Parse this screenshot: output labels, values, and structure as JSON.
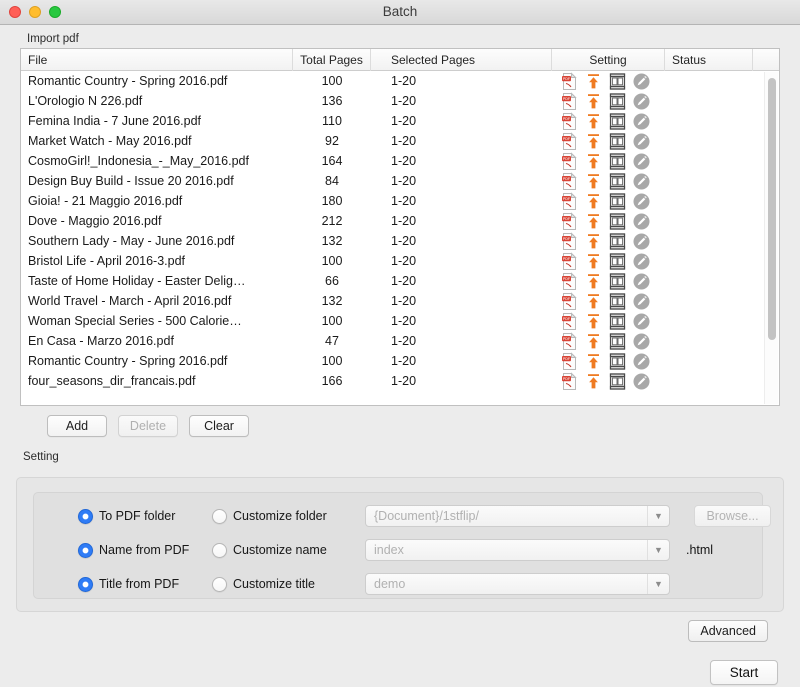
{
  "window": {
    "title": "Batch",
    "traffic_lights": [
      "close-red",
      "minimize-yellow",
      "zoom-green"
    ]
  },
  "import_section": {
    "label": "Import pdf",
    "columns": [
      "File",
      "Total Pages",
      "Selected Pages",
      "Setting",
      "Status"
    ],
    "row_icons": [
      "pdf-file-icon",
      "orange-up-arrow-icon",
      "page-template-icon",
      "gray-pencil-edit-icon"
    ],
    "rows": [
      {
        "file": "Romantic Country - Spring 2016.pdf",
        "total_pages": "100",
        "selected_pages": "1-20",
        "status": ""
      },
      {
        "file": "L'Orologio N 226.pdf",
        "total_pages": "136",
        "selected_pages": "1-20",
        "status": ""
      },
      {
        "file": "Femina India - 7 June 2016.pdf",
        "total_pages": "110",
        "selected_pages": "1-20",
        "status": ""
      },
      {
        "file": "Market Watch - May 2016.pdf",
        "total_pages": "92",
        "selected_pages": "1-20",
        "status": ""
      },
      {
        "file": "CosmoGirl!_Indonesia_-_May_2016.pdf",
        "total_pages": "164",
        "selected_pages": "1-20",
        "status": ""
      },
      {
        "file": "Design Buy Build - Issue 20 2016.pdf",
        "total_pages": "84",
        "selected_pages": "1-20",
        "status": ""
      },
      {
        "file": "Gioia! - 21 Maggio 2016.pdf",
        "total_pages": "180",
        "selected_pages": "1-20",
        "status": ""
      },
      {
        "file": "Dove - Maggio 2016.pdf",
        "total_pages": "212",
        "selected_pages": "1-20",
        "status": ""
      },
      {
        "file": "Southern Lady - May - June 2016.pdf",
        "total_pages": "132",
        "selected_pages": "1-20",
        "status": ""
      },
      {
        "file": "Bristol Life - April 2016-3.pdf",
        "total_pages": "100",
        "selected_pages": "1-20",
        "status": ""
      },
      {
        "file": "Taste of Home Holiday - Easter Delig…",
        "total_pages": "66",
        "selected_pages": "1-20",
        "status": ""
      },
      {
        "file": "World Travel - March - April 2016.pdf",
        "total_pages": "132",
        "selected_pages": "1-20",
        "status": ""
      },
      {
        "file": "Woman Special Series - 500 Calorie…",
        "total_pages": "100",
        "selected_pages": "1-20",
        "status": ""
      },
      {
        "file": "En Casa - Marzo 2016.pdf",
        "total_pages": "47",
        "selected_pages": "1-20",
        "status": ""
      },
      {
        "file": "Romantic Country - Spring 2016.pdf",
        "total_pages": "100",
        "selected_pages": "1-20",
        "status": ""
      },
      {
        "file": "four_seasons_dir_francais.pdf",
        "total_pages": "166",
        "selected_pages": "1-20",
        "status": ""
      }
    ],
    "buttons": {
      "add": "Add",
      "delete": "Delete",
      "clear": "Clear"
    }
  },
  "setting_section": {
    "label": "Setting",
    "rows": [
      {
        "primary_option": "To PDF folder",
        "custom_option": "Customize folder",
        "combo_value": "{Document}/1stflip/",
        "trailing": "Browse..."
      },
      {
        "primary_option": "Name from PDF",
        "custom_option": "Customize name",
        "combo_value": "index",
        "trailing": ".html"
      },
      {
        "primary_option": "Title from PDF",
        "custom_option": "Customize title",
        "combo_value": "demo",
        "trailing": ""
      }
    ],
    "advanced_label": "Advanced"
  },
  "footer": {
    "start_label": "Start"
  },
  "colors": {
    "radio_selected": "#2f7cf6",
    "pdf_icon": "#d94436",
    "arrow_icon": "#ef7b22",
    "window_bg": "#ececec"
  }
}
